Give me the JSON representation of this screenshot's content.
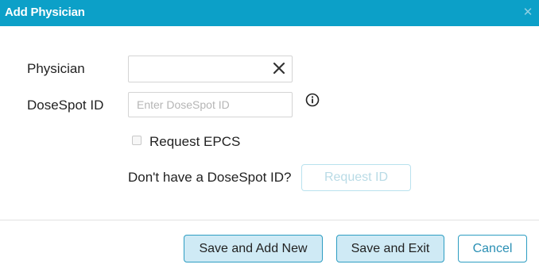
{
  "dialog": {
    "title": "Add Physician",
    "close_icon": "close-icon"
  },
  "form": {
    "physician": {
      "label": "Physician",
      "value": "",
      "clear_icon": "clear-icon"
    },
    "dosespot_id": {
      "label": "DoseSpot ID",
      "value": "",
      "placeholder": "Enter DoseSpot ID",
      "info_icon": "info-icon"
    },
    "request_epcs": {
      "label": "Request EPCS",
      "checked": false
    },
    "no_id_prompt": "Don't have a DoseSpot ID?",
    "request_id_label": "Request ID"
  },
  "footer": {
    "save_add_new_label": "Save and Add New",
    "save_exit_label": "Save and Exit",
    "cancel_label": "Cancel"
  },
  "colors": {
    "header": "#0ca0c8",
    "button_border": "#2d9dc2",
    "button_fill": "#cfeaf5"
  }
}
